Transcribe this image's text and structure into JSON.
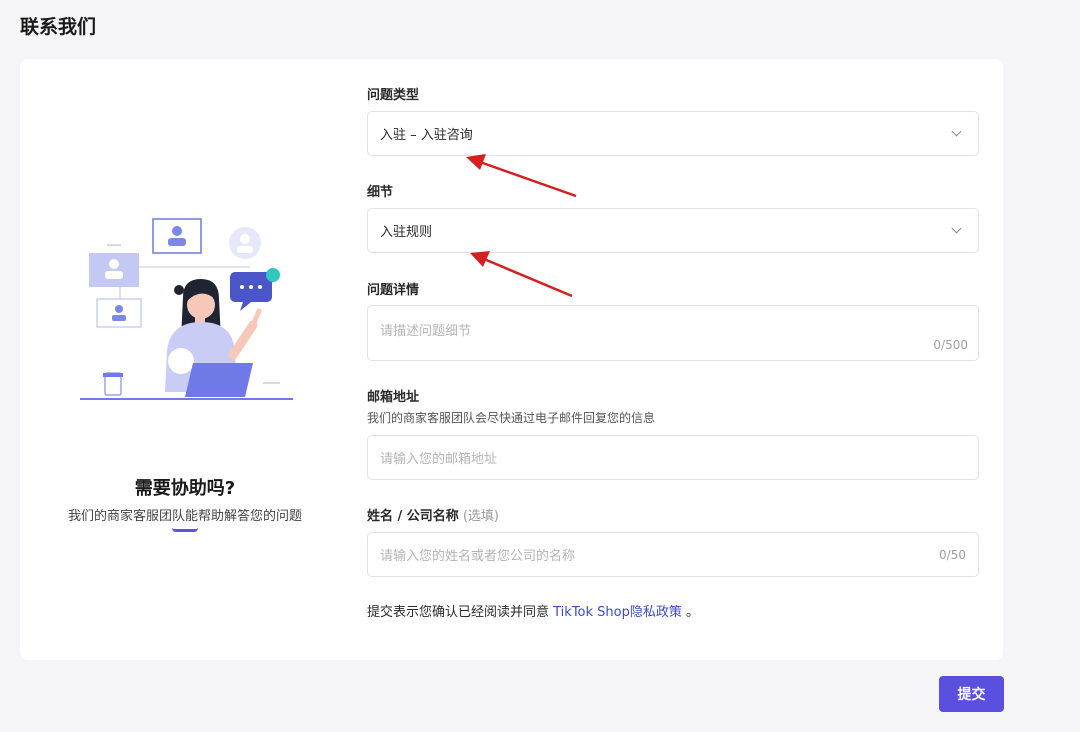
{
  "page": {
    "title": "联系我们"
  },
  "help": {
    "title": "需要协助吗?",
    "subtitle": "我们的商家客服团队能帮助解答您的问题"
  },
  "form": {
    "issue_type": {
      "label": "问题类型",
      "value": "入驻 – 入驻咨询"
    },
    "detail": {
      "label": "细节",
      "value": "入驻规则"
    },
    "description": {
      "label": "问题详情",
      "placeholder": "请描述问题细节",
      "counter": "0/500"
    },
    "email": {
      "label": "邮箱地址",
      "hint": "我们的商家客服团队会尽快通过电子邮件回复您的信息",
      "placeholder": "请输入您的邮箱地址"
    },
    "name": {
      "label": "姓名 / 公司名称",
      "optional": "(选填)",
      "placeholder": "请输入您的姓名或者您公司的名称",
      "counter": "0/50"
    },
    "agreement": {
      "prefix": "提交表示您确认已经阅读并同意 ",
      "link": "TikTok Shop隐私政策",
      "suffix": " 。"
    },
    "submit_label": "提交"
  },
  "colors": {
    "accent": "#5b4fe0",
    "annotation_arrow": "#d42020"
  }
}
